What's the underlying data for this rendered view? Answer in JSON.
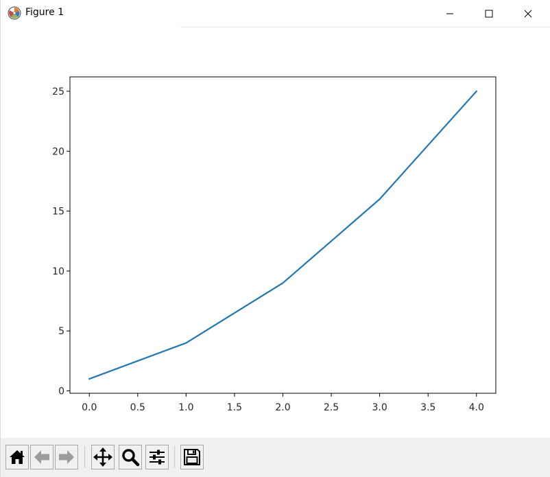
{
  "window": {
    "title": "Figure 1",
    "icons": {
      "app": "matplotlib-icon",
      "minimize": "minimize-icon",
      "maximize": "maximize-icon",
      "close": "close-icon"
    }
  },
  "toolbar": {
    "buttons": [
      {
        "name": "home-button",
        "icon": "home-icon"
      },
      {
        "name": "back-button",
        "icon": "back-arrow-icon"
      },
      {
        "name": "forward-button",
        "icon": "forward-arrow-icon"
      },
      {
        "name": "pan-button",
        "icon": "pan-move-icon"
      },
      {
        "name": "zoom-button",
        "icon": "zoom-magnifier-icon"
      },
      {
        "name": "configure-subplots-button",
        "icon": "sliders-icon"
      },
      {
        "name": "save-button",
        "icon": "floppy-disk-icon"
      }
    ]
  },
  "chart_data": {
    "type": "line",
    "x": [
      0,
      1,
      2,
      3,
      4
    ],
    "series": [
      {
        "values": [
          1,
          4,
          9,
          16,
          25
        ],
        "color": "#1f77b4"
      }
    ],
    "xlim": [
      -0.2,
      4.2
    ],
    "ylim": [
      -0.2,
      26.2
    ],
    "xticks": [
      0.0,
      0.5,
      1.0,
      1.5,
      2.0,
      2.5,
      3.0,
      3.5,
      4.0
    ],
    "xtick_labels": [
      "0.0",
      "0.5",
      "1.0",
      "1.5",
      "2.0",
      "2.5",
      "3.0",
      "3.5",
      "4.0"
    ],
    "yticks": [
      0,
      5,
      10,
      15,
      20,
      25
    ],
    "ytick_labels": [
      "0",
      "5",
      "10",
      "15",
      "20",
      "25"
    ],
    "grid": false
  }
}
